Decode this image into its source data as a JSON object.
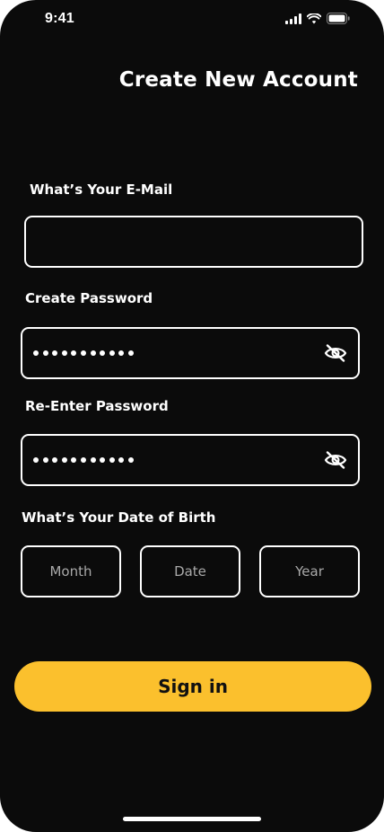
{
  "status_bar": {
    "time": "9:41",
    "icons": [
      "cellular-signal-icon",
      "wifi-icon",
      "battery-icon"
    ]
  },
  "header": {
    "title": "Create New Account"
  },
  "form": {
    "email": {
      "label": "What’s Your E-Mail",
      "value": "",
      "placeholder": ""
    },
    "password": {
      "label": "Create Password",
      "masked_length": 11,
      "toggle_icon": "eye-off-icon"
    },
    "confirm_password": {
      "label": "Re-Enter Password",
      "masked_length": 11,
      "toggle_icon": "eye-off-icon"
    },
    "date_of_birth": {
      "label": "What’s Your Date of Birth",
      "month_placeholder": "Month",
      "day_placeholder": "Date",
      "year_placeholder": "Year"
    }
  },
  "actions": {
    "submit_label": "Sign in"
  },
  "colors": {
    "background": "#0b0b0b",
    "accent": "#fbc02d",
    "text": "#ffffff",
    "placeholder": "#a9a9a9"
  }
}
